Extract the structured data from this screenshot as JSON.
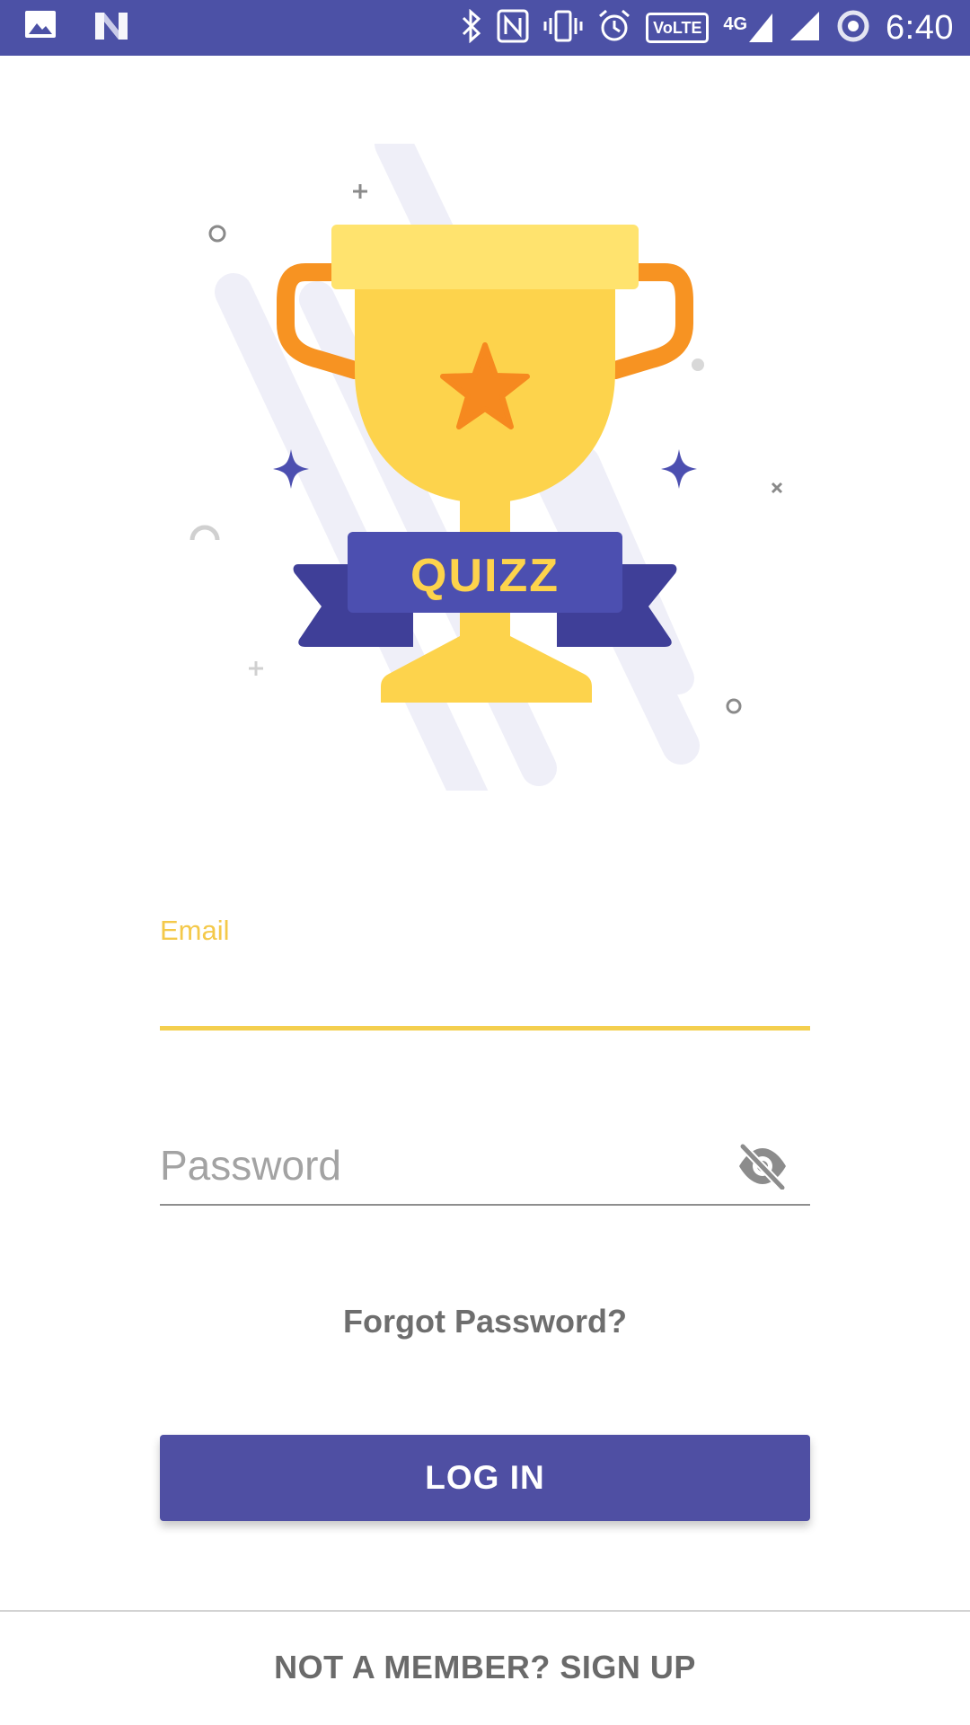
{
  "status_bar": {
    "time": "6:40",
    "network_label": "4G",
    "volte_label": "VoLTE",
    "icons": [
      "image-icon",
      "n-logo-icon",
      "bluetooth-icon",
      "nfc-icon",
      "vibrate-icon",
      "alarm-icon",
      "volte-icon",
      "signal-4g-icon",
      "signal-icon",
      "data-saver-icon"
    ]
  },
  "hero": {
    "banner_text": "QUIZZ",
    "colors": {
      "trophy_light": "#ffe36e",
      "trophy_main": "#fdd34c",
      "handles": "#f79322",
      "star": "#f6891f",
      "ribbon": "#4c4fb0",
      "ribbon_dark": "#3f3f98",
      "streaks": "#efeff8"
    }
  },
  "form": {
    "email_label": "Email",
    "email_value": "",
    "password_placeholder": "Password",
    "password_value": "",
    "forgot_label": "Forgot Password?",
    "login_label": "LOG IN",
    "signup_label": "NOT A MEMBER? SIGN UP"
  },
  "theme": {
    "primary": "#4f4fa3",
    "accent": "#f4cf4f"
  }
}
